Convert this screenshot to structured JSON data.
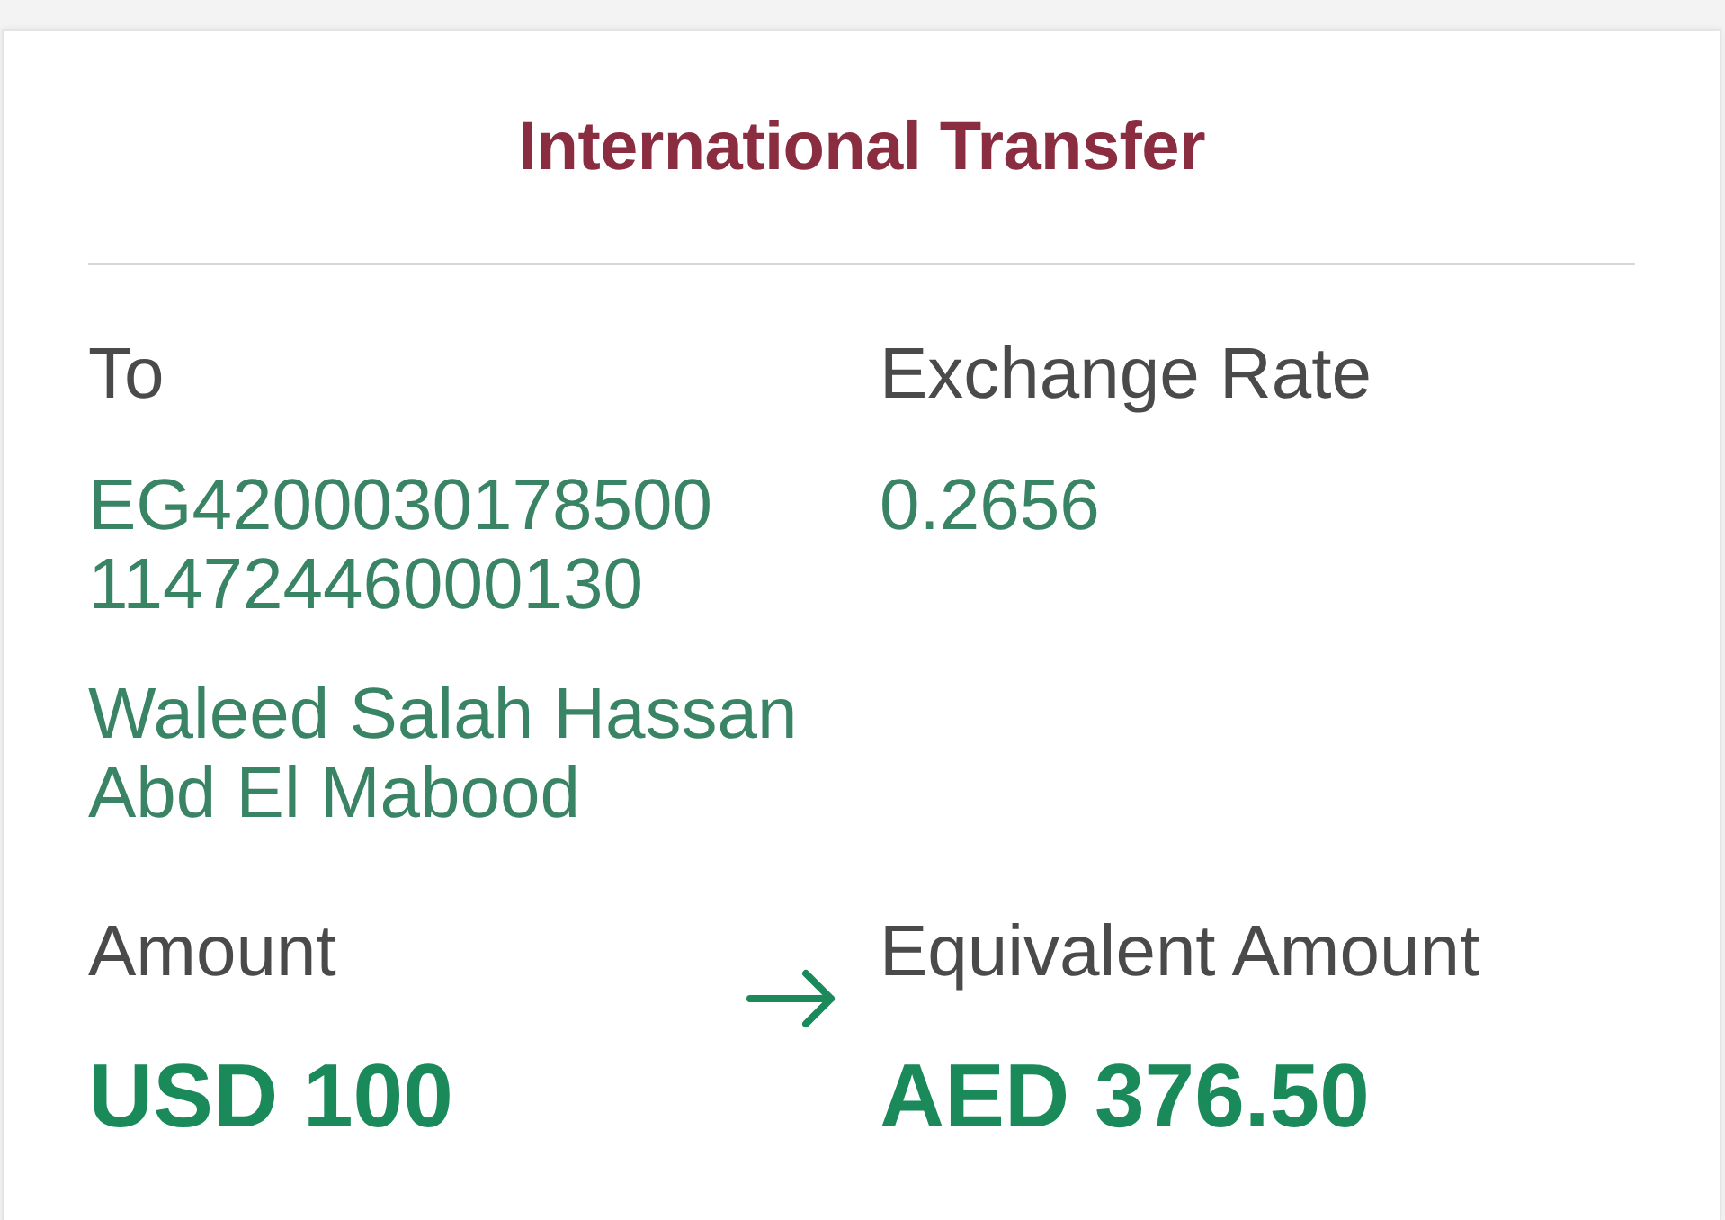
{
  "header": {
    "title": "International Transfer"
  },
  "recipient": {
    "label": "To",
    "account_lines": [
      "EG4200030178500",
      "11472446000130"
    ],
    "name": "Waleed Salah Hassan Abd El Mabood"
  },
  "exchange_rate": {
    "label": "Exchange Rate",
    "value": "0.2656"
  },
  "amount": {
    "label": "Amount",
    "value": "USD 100"
  },
  "equivalent_amount": {
    "label": "Equivalent Amount",
    "value": "AED 376.50"
  }
}
